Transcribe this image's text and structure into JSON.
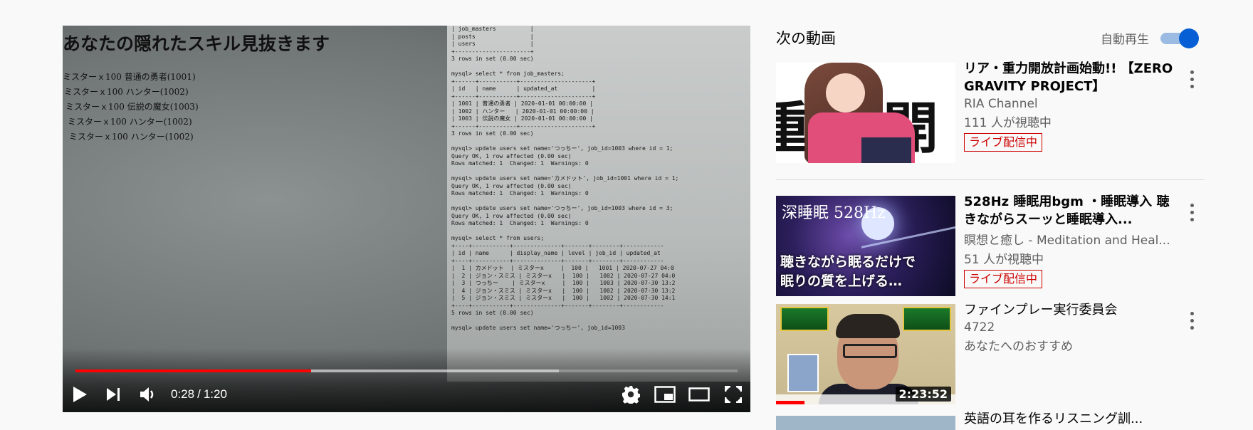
{
  "player": {
    "time_current": "0:28",
    "time_separator": "/",
    "time_total": "1:20",
    "progress_played": 0.356,
    "progress_buffered": 0.73,
    "video_frame": {
      "heading": "あなたの隠れたスキル見抜きます",
      "skill_lines": [
        "ミスターｘ100 普通の勇者(1001)",
        "ミスターｘ100 ハンター(1002)",
        "ミスターｘ100 伝説の魔女(1003)",
        "ミスターｘ100 ハンター(1002)",
        "ミスターｘ100 ハンター(1002)"
      ],
      "terminal_lines": [
        "| job_masters          |",
        "| posts                |",
        "| users                |",
        "+----------------------+",
        "3 rows in set (0.00 sec)",
        "",
        "mysql> select * from job_masters;",
        "+------+-----------+---------------------+",
        "| id   | name      | updated_at          |",
        "+------+-----------+---------------------+",
        "| 1001 | 普通の勇者 | 2020-01-01 00:00:00 |",
        "| 1002 | ハンター   | 2020-01-01 00:00:00 |",
        "| 1003 | 伝説の魔女 | 2020-01-01 00:00:00 |",
        "+------+-----------+---------------------+",
        "3 rows in set (0.00 sec)",
        "",
        "mysql> update users set name='つっちー', job_id=1003 where id = 1;",
        "Query OK, 1 row affected (0.00 sec)",
        "Rows matched: 1  Changed: 1  Warnings: 0",
        "",
        "mysql> update users set name='カメドット', job_id=1001 where id = 1;",
        "Query OK, 1 row affected (0.00 sec)",
        "Rows matched: 1  Changed: 1  Warnings: 0",
        "",
        "mysql> update users set name='つっちー', job_id=1003 where id = 3;",
        "Query OK, 1 row affected (0.00 sec)",
        "Rows matched: 1  Changed: 1  Warnings: 0",
        "",
        "mysql> select * from users;",
        "+----+-----------+--------------+-------+--------+------------",
        "| id | name      | display_name | level | job_id | updated_at",
        "+----+-----------+--------------+-------+--------+------------",
        "|  1 | カメドット  | ミスターx     |  100 |   1001 | 2020-07-27 04:0",
        "|  2 | ジョン・スミス | ミスターx   |  100 |   1002 | 2020-07-27 04:0",
        "|  3 | つっちー    | ミスターx     |  100 |   1003 | 2020-07-30 13:2",
        "|  4 | ジョン・スミス | ミスターx   |  100 |   1002 | 2020-07-30 13:2",
        "|  5 | ジョン・スミス | ミスターx   |  100 |   1002 | 2020-07-30 14:1",
        "+----+-----------+--------------+-------+--------+------------",
        "5 rows in set (0.00 sec)",
        "",
        "mysql> update users set name='つっちー', job_id=1003"
      ]
    }
  },
  "sidebar": {
    "up_next_title": "次の動画",
    "autoplay_label": "自動再生",
    "autoplay_on": true,
    "videos": [
      {
        "title": "リア・重力開放計画始動!! 【ZERO GRAVITY PROJECT】",
        "channel": "RIA Channel",
        "viewers": "111 人が視聴中",
        "badge": "ライブ配信中",
        "thumb_text": "重 開放"
      },
      {
        "title": "528Hz 睡眠用bgm ・睡眠導入 聴きながらスーッと睡眠導入...",
        "channel": "瞑想と癒し - Meditation and Heal...",
        "viewers": "51 人が視聴中",
        "badge": "ライブ配信中",
        "thumb_top_text": "深睡眠 528Hz",
        "thumb_bottom_text_1": "聴きながら眠るだけで",
        "thumb_bottom_text_2": "眠りの質を上げる…"
      },
      {
        "title": "ファインプレー実行委員会",
        "channel": "4722",
        "viewers": "あなたへのおすすめ",
        "duration": "2:23:52"
      },
      {
        "title": "英語の耳を作るリスニング訓..."
      }
    ]
  }
}
